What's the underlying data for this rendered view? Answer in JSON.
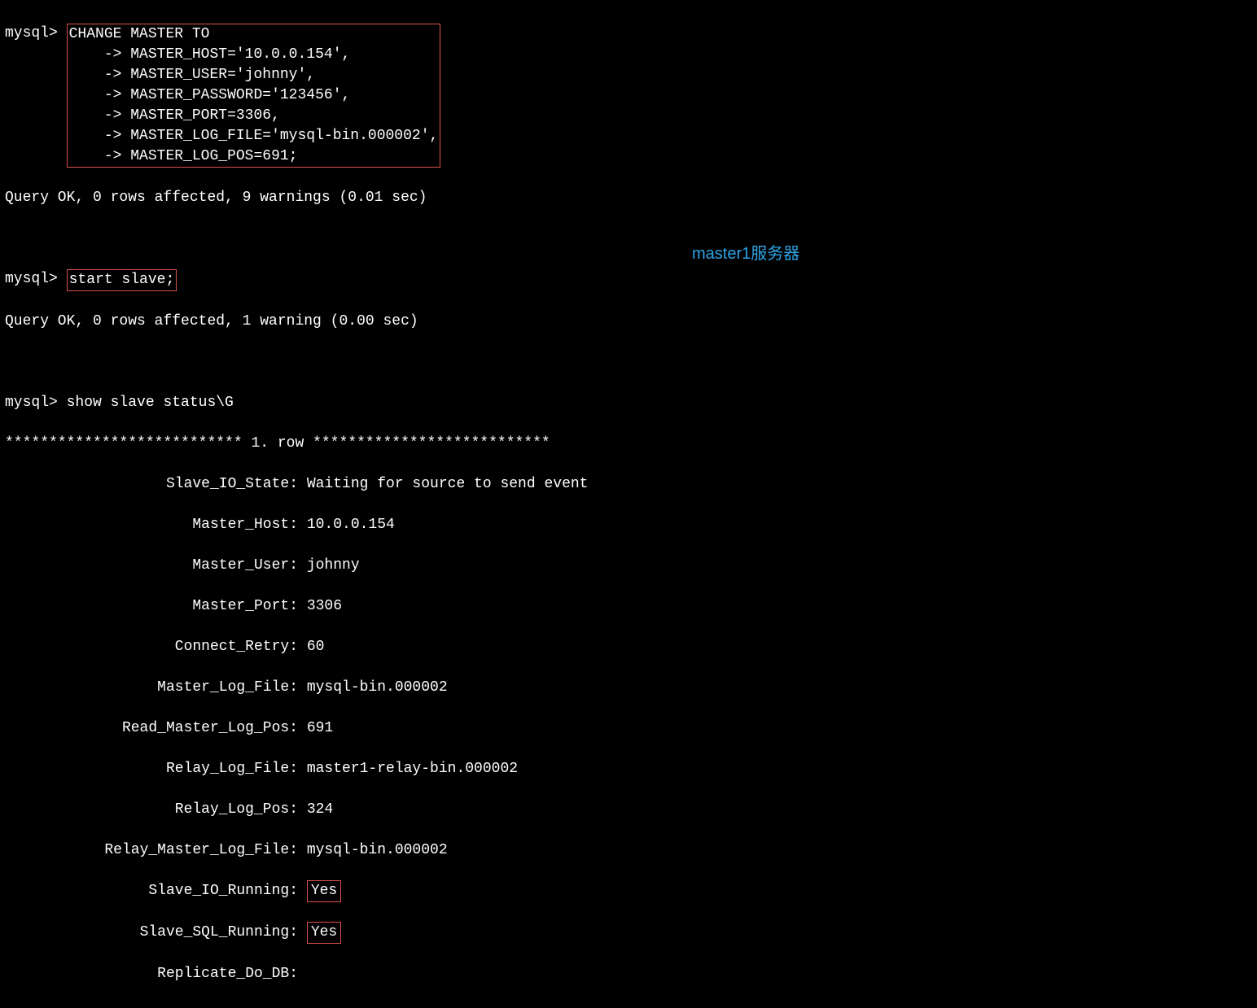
{
  "prompt": "mysql>",
  "cont": "    ->",
  "cmd1": {
    "l1": "CHANGE MASTER TO",
    "l2": "MASTER_HOST='10.0.0.154',",
    "l3": "MASTER_USER='johnny',",
    "l4": "MASTER_PASSWORD='123456',",
    "l5": "MASTER_PORT=3306,",
    "l6": "MASTER_LOG_FILE='mysql-bin.000002',",
    "l7": "MASTER_LOG_POS=691;"
  },
  "result1": "Query OK, 0 rows affected, 9 warnings (0.01 sec)",
  "cmd2": "start slave;",
  "result2": "Query OK, 0 rows affected, 1 warning (0.00 sec)",
  "cmd3": "show slave status\\G",
  "rowheader": "*************************** 1. row ***************************",
  "status": {
    "Slave_IO_State": "Waiting for source to send event",
    "Master_Host": "10.0.0.154",
    "Master_User": "johnny",
    "Master_Port": "3306",
    "Connect_Retry": "60",
    "Master_Log_File": "mysql-bin.000002",
    "Read_Master_Log_Pos": "691",
    "Relay_Log_File": "master1-relay-bin.000002",
    "Relay_Log_Pos": "324",
    "Relay_Master_Log_File": "mysql-bin.000002",
    "Slave_IO_Running": "Yes",
    "Slave_SQL_Running": "Yes",
    "Replicate_Do_DB": ""
  },
  "labels": {
    "Slave_IO_State": "Slave_IO_State:",
    "Master_Host": "Master_Host:",
    "Master_User": "Master_User:",
    "Master_Port": "Master_Port:",
    "Connect_Retry": "Connect_Retry:",
    "Master_Log_File": "Master_Log_File:",
    "Read_Master_Log_Pos": "Read_Master_Log_Pos:",
    "Relay_Log_File": "Relay_Log_File:",
    "Relay_Log_Pos": "Relay_Log_Pos:",
    "Relay_Master_Log_File": "Relay_Master_Log_File:",
    "Slave_IO_Running": "Slave_IO_Running:",
    "Slave_SQL_Running": "Slave_SQL_Running:",
    "Replicate_Do_DB": "Replicate_Do_DB:"
  },
  "annotation": "master1服务器"
}
